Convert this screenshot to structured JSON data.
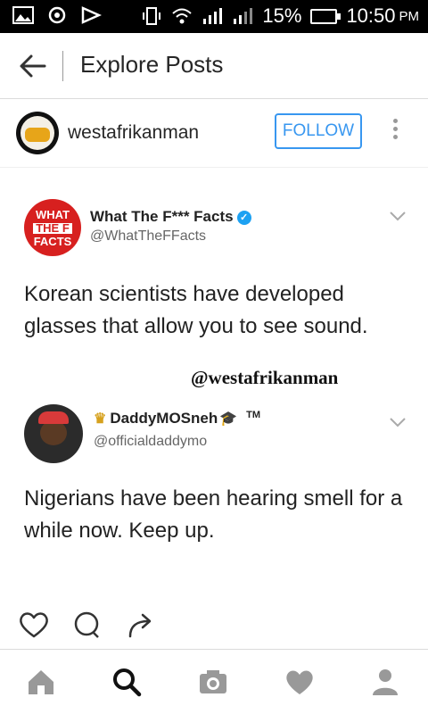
{
  "status_bar": {
    "battery": "15%",
    "time": "10:50",
    "ampm": "PM"
  },
  "app_bar": {
    "title": "Explore Posts"
  },
  "post_header": {
    "username": "westafrikanman",
    "follow_label": "FOLLOW"
  },
  "tweet1": {
    "display_name": "What The F*** Facts",
    "handle": "@WhatTheFFacts",
    "logo_text_1": "WHAT",
    "logo_text_2": "THE F",
    "logo_text_3": "FACTS",
    "text": "Korean scientists have developed glasses that allow you to see sound."
  },
  "watermark": "@westafrikanman",
  "tweet2": {
    "display_name": "DaddyMOSneh",
    "tm": "TM",
    "handle": "@officialdaddymo",
    "text": "Nigerians have been hearing smell for a while now. Keep up."
  },
  "colors": {
    "accent": "#3897f0",
    "verified": "#1da1f2",
    "logo_red": "#d7201f"
  },
  "icons": {
    "actions": [
      "heart-icon",
      "comment-icon",
      "share-icon"
    ],
    "tabs": [
      "home-icon",
      "search-icon",
      "camera-icon",
      "heart-icon",
      "profile-icon"
    ]
  }
}
